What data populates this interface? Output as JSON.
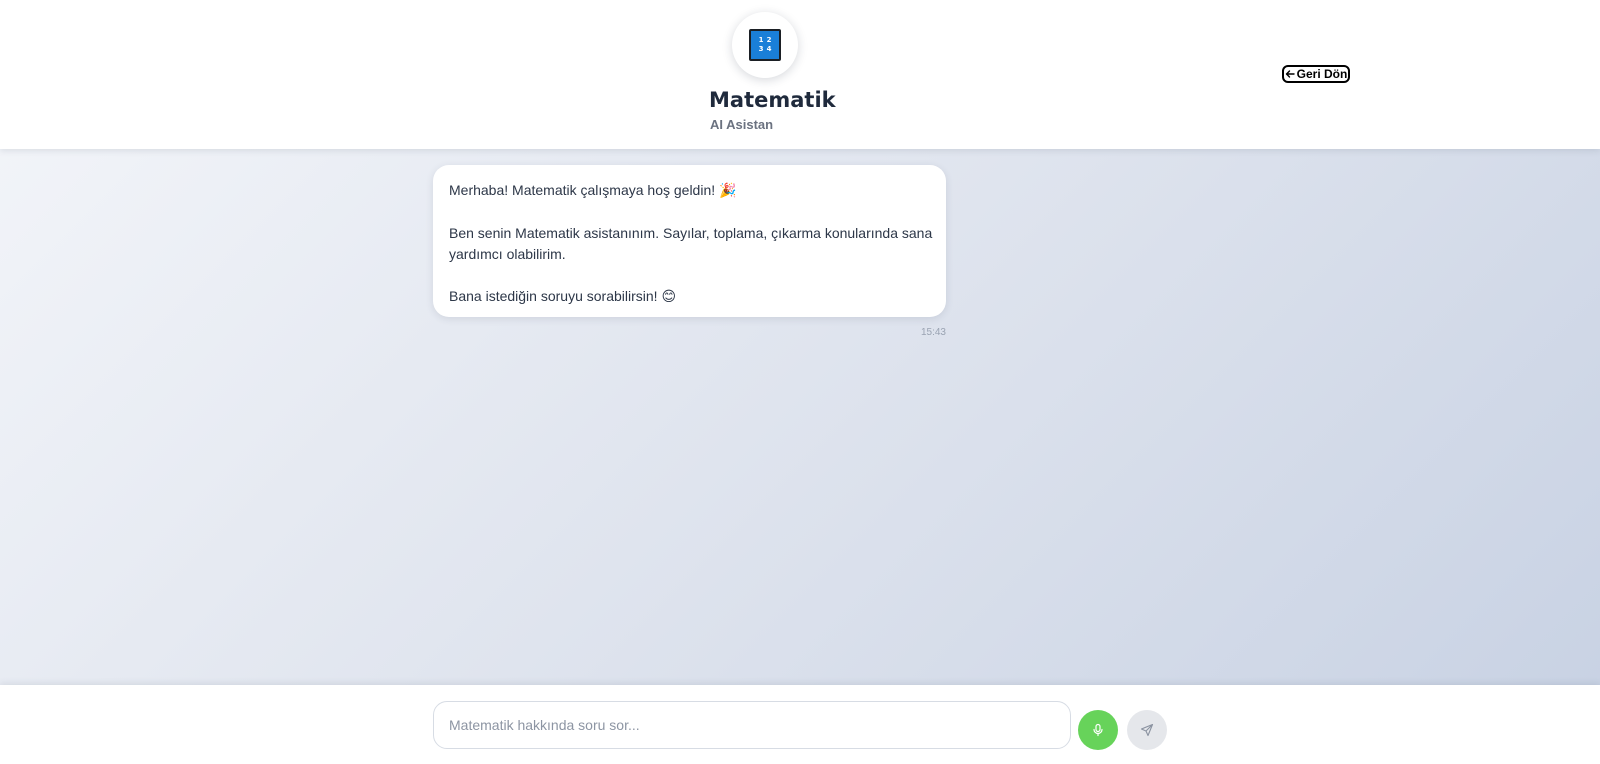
{
  "header": {
    "logo_digits": [
      "1",
      "2",
      "3",
      "4"
    ],
    "title": "Matematik",
    "subtitle": "AI Asistan",
    "back_label": "Geri Dön"
  },
  "chat": {
    "messages": [
      {
        "sender": "assistant",
        "lines": [
          "Merhaba! Matematik çalışmaya hoş geldin!",
          "Ben senin Matematik asistanınım. Sayılar, toplama, çıkarma konularında sana",
          "yardımcı olabilirim.",
          "Bana istediğin soruyu sorabilirsin!"
        ],
        "emojis": [
          "🎉",
          "😊"
        ],
        "time": "15:43"
      }
    ]
  },
  "composer": {
    "placeholder": "Matematik hakkında soru sor...",
    "value": ""
  },
  "colors": {
    "logo_tile": "#1a7fd8",
    "mic_button": "#67d35a",
    "send_button": "#e5e7eb"
  },
  "icons": {
    "back": "arrow-left-icon",
    "mic": "microphone-icon",
    "send": "send-icon"
  }
}
